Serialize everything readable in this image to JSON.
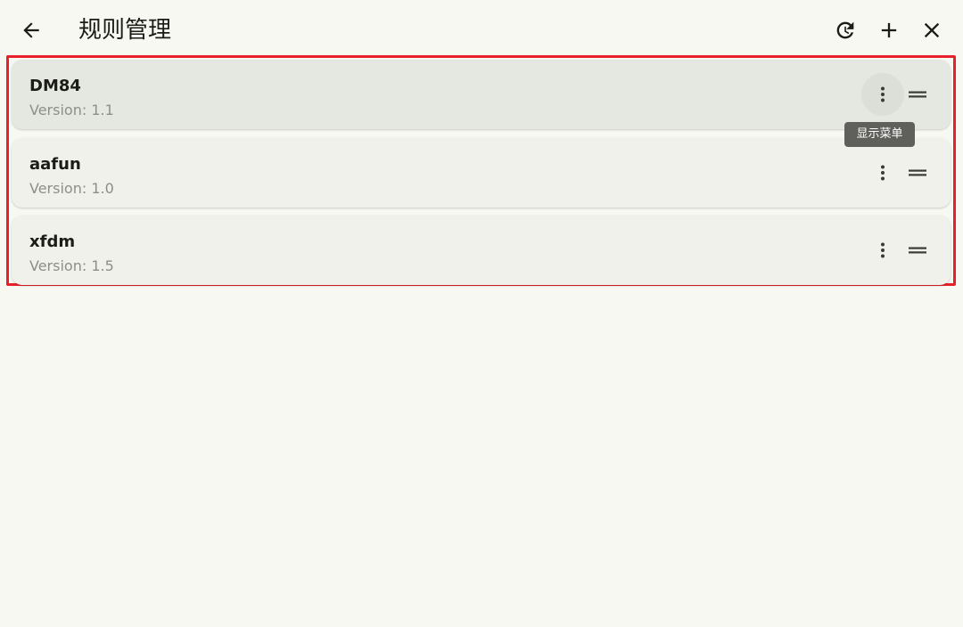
{
  "app_bar": {
    "title": "规则管理",
    "icons": {
      "back": "arrow-back-icon",
      "refresh": "refresh-icon",
      "add": "add-icon",
      "close": "close-icon"
    }
  },
  "rules": [
    {
      "name": "DM84",
      "version": "Version: 1.1"
    },
    {
      "name": "aafun",
      "version": "Version: 1.0"
    },
    {
      "name": "xfdm",
      "version": "Version: 1.5"
    }
  ],
  "tooltip": {
    "text": "显示菜单"
  },
  "colors": {
    "background": "#f6f8f1",
    "card": "#eff1ea",
    "card_active": "#e5e8e1",
    "highlight_border": "#e8202a",
    "tooltip_bg": "#5f605c",
    "secondary_text": "#8c8f88"
  }
}
